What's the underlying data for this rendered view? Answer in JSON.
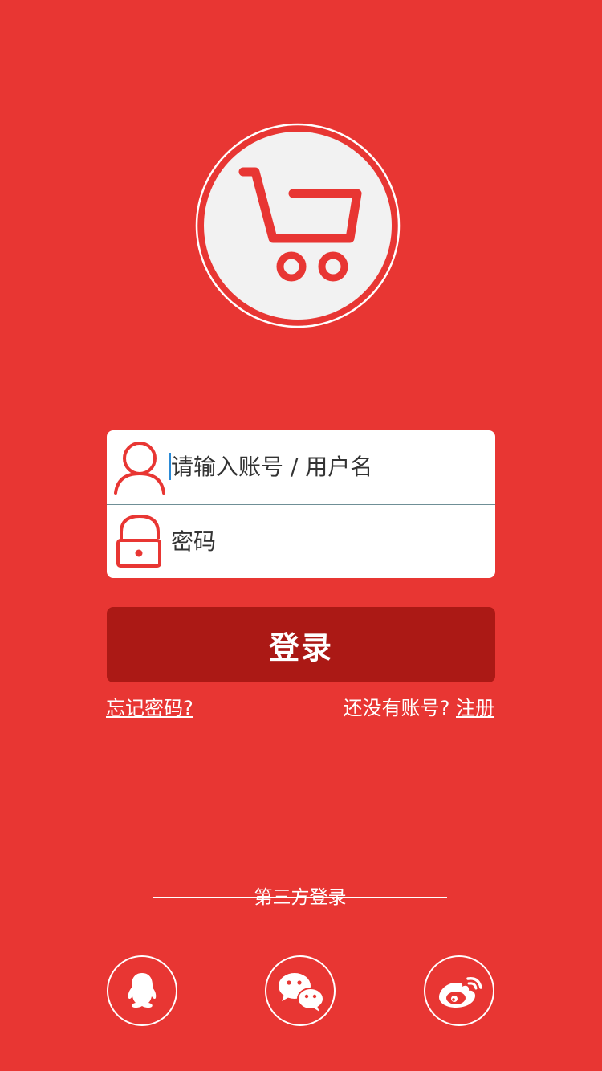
{
  "theme": {
    "background": "#e83633",
    "button": "#ab1915",
    "logo_bg": "#f2f2f2"
  },
  "logo": {
    "icon": "shopping-cart-icon"
  },
  "form": {
    "username_placeholder": "请输入账号 / 用户名",
    "password_placeholder": "密码",
    "user_icon": "user-icon",
    "lock_icon": "lock-icon"
  },
  "actions": {
    "login_label": "登录",
    "forgot_password": "忘记密码?",
    "no_account_text": "还没有账号? ",
    "register": "注册"
  },
  "third_party": {
    "title": "第三方登录",
    "providers": [
      {
        "icon": "qq-icon"
      },
      {
        "icon": "wechat-icon"
      },
      {
        "icon": "weibo-icon"
      }
    ]
  }
}
